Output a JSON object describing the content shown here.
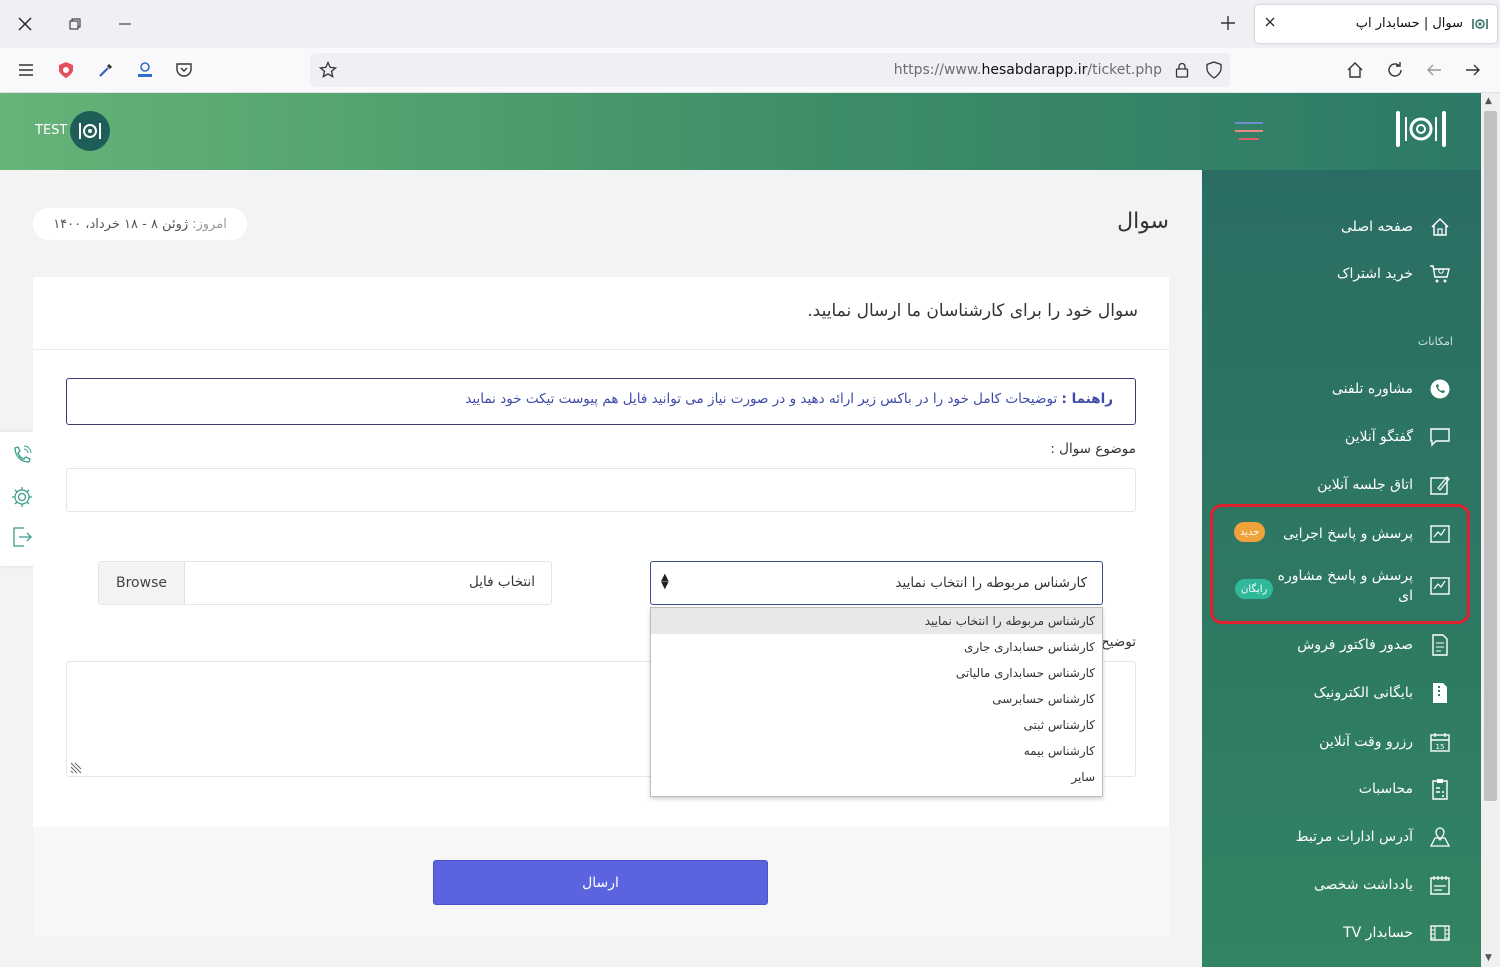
{
  "browser": {
    "tab_title": "سوال | حسابدار اپ",
    "url_prefix": "https://www.",
    "url_domain": "hesabdarapp.ir",
    "url_path": "/ticket.php"
  },
  "header": {
    "user_label": "TEST"
  },
  "page": {
    "title": "سوال",
    "date_label": "امروز:",
    "date_value": "ژوئن ۸ - ۱۸ خرداد، ۱۴۰۰"
  },
  "form": {
    "card_title": "سوال خود را برای کارشناسان ما ارسال نمایید.",
    "guide_label": "راهنما :",
    "guide_text": "توضیحات کامل خود را در باکس زیر ارائه دهید و در صورت نیاز می توانید فایل هم پیوست تیکت خود نمایید",
    "subject_label": "موضوع سوال :",
    "subject_value": "",
    "expert_selected": "کارشناس مربوطه را انتخاب نمایید",
    "expert_options": [
      "کارشناس مربوطه را انتخاب نمایید",
      "کارشناس حسابداری جاری",
      "کارشناس حسابداری مالیاتی",
      "کارشناس حسابرسی",
      "کارشناس ثبتی",
      "کارشناس بیمه",
      "سایر"
    ],
    "file_label": "انتخاب فایل",
    "browse_label": "Browse",
    "description_label": "توضیح",
    "submit_label": "ارسال"
  },
  "sidebar": {
    "section_label": "امکانات",
    "items": [
      {
        "label": "صفحه اصلی",
        "icon": "home-icon"
      },
      {
        "label": "خرید اشتراک",
        "icon": "cart-icon"
      },
      {
        "label": "مشاوره تلفنی",
        "icon": "whatsapp-icon"
      },
      {
        "label": "گفتگو آنلاین",
        "icon": "chat-icon"
      },
      {
        "label": "اتاق جلسه آنلاین",
        "icon": "meeting-icon"
      },
      {
        "label": "پرسش و پاسخ اجرایی",
        "icon": "qa-icon",
        "badge": "جدید"
      },
      {
        "label": "پرسش و پاسخ مشاوره ای",
        "icon": "qa-icon",
        "badge": "رایگان"
      },
      {
        "label": "صدور فاکتور فروش",
        "icon": "invoice-icon"
      },
      {
        "label": "بایگانی الکترونیک",
        "icon": "archive-icon"
      },
      {
        "label": "رزرو وقت آنلاین",
        "icon": "calendar-icon"
      },
      {
        "label": "محاسبات",
        "icon": "calculator-icon"
      },
      {
        "label": "آدرس ادارات مرتبط",
        "icon": "map-icon"
      },
      {
        "label": "یادداشت شخصی",
        "icon": "notes-icon"
      },
      {
        "label": "حسابدار TV",
        "icon": "film-icon"
      }
    ]
  },
  "colors": {
    "header_start": "#66b478",
    "sidebar": "#2e7a63",
    "accent_button": "#5b63de",
    "badge_new": "#f0a23a",
    "badge_free": "#2fb89a",
    "highlight": "#e0202e"
  }
}
